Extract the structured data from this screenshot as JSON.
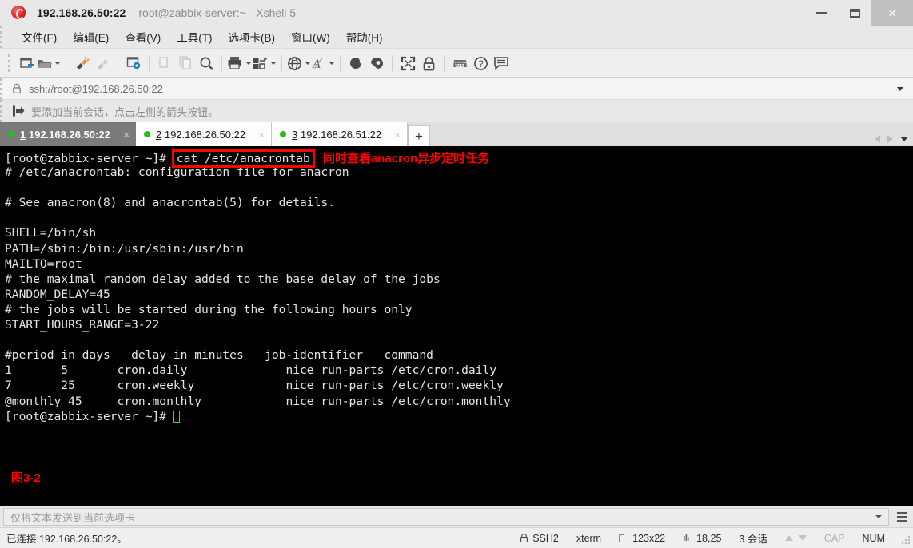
{
  "window": {
    "ip_title": "192.168.26.50:22",
    "subtitle": "root@zabbix-server:~ - Xshell 5",
    "minimize": "–",
    "maximize": "□",
    "close": "×"
  },
  "menu": {
    "items": [
      {
        "label": "文件(F)"
      },
      {
        "label": "编辑(E)"
      },
      {
        "label": "查看(V)"
      },
      {
        "label": "工具(T)"
      },
      {
        "label": "选项卡(B)"
      },
      {
        "label": "窗口(W)"
      },
      {
        "label": "帮助(H)"
      }
    ]
  },
  "toolbar": {
    "icons": [
      "new-session-icon",
      "open-folder-icon",
      "connect-icon",
      "disconnect-icon",
      "session-properties-icon",
      "copy-icon",
      "paste-icon",
      "find-icon",
      "print-icon",
      "file-transfer-icon",
      "globe-icon",
      "font-icon",
      "shell-icon",
      "shell-alt-icon",
      "fullscreen-icon",
      "lock-icon",
      "keyboard-icon",
      "help-icon",
      "comment-icon"
    ]
  },
  "address": {
    "url": "ssh://root@192.168.26.50:22"
  },
  "hint": {
    "text": "要添加当前会话，点击左侧的箭头按钮。"
  },
  "tabs": {
    "items": [
      {
        "index": "1",
        "label": "192.168.26.50:22",
        "active": true,
        "close": "×"
      },
      {
        "index": "2",
        "label": "192.168.26.50:22",
        "active": false,
        "close": "×"
      },
      {
        "index": "3",
        "label": "192.168.26.51:22",
        "active": false,
        "close": "×"
      }
    ],
    "add_label": "+"
  },
  "terminal": {
    "prompt": "[root@zabbix-server ~]# ",
    "command": "cat /etc/anacrontab",
    "annotation": "同时查看anacron异步定时任务",
    "lines": [
      "# /etc/anacrontab: configuration file for anacron",
      "",
      "# See anacron(8) and anacrontab(5) for details.",
      "",
      "SHELL=/bin/sh",
      "PATH=/sbin:/bin:/usr/sbin:/usr/bin",
      "MAILTO=root",
      "# the maximal random delay added to the base delay of the jobs",
      "RANDOM_DELAY=45",
      "# the jobs will be started during the following hours only",
      "START_HOURS_RANGE=3-22",
      "",
      "#period in days   delay in minutes   job-identifier   command",
      "1       5       cron.daily              nice run-parts /etc/cron.daily",
      "7       25      cron.weekly             nice run-parts /etc/cron.weekly",
      "@monthly 45     cron.monthly            nice run-parts /etc/cron.monthly"
    ],
    "final_prompt": "[root@zabbix-server ~]# ",
    "figure_caption": "图3-2"
  },
  "sendbar": {
    "placeholder": "仅将文本发送到当前选项卡"
  },
  "status": {
    "connection": "已连接 192.168.26.50:22。",
    "protocol": "SSH2",
    "terminal_type": "xterm",
    "size": "123x22",
    "cursor_pos": "18,25",
    "sessions": "3 会话",
    "cap": "CAP",
    "num": "NUM"
  },
  "colors": {
    "annotation_red": "#ff0000",
    "tab_active_bg": "#7a7a7a",
    "terminal_bg": "#000000",
    "status_dot_green": "#20c020"
  }
}
